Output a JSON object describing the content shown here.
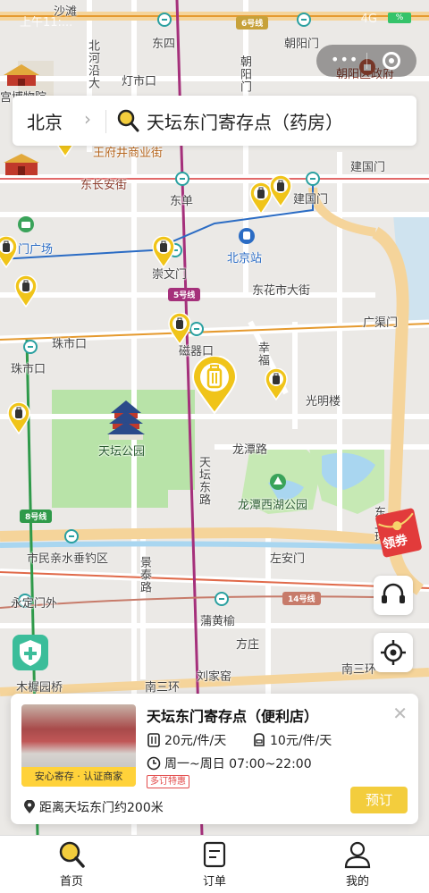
{
  "status_bar": {
    "carrier": "上午11:...",
    "signal": "4G",
    "battery": "%"
  },
  "search": {
    "city": "北京",
    "query": "天坛东门寄存点（药房）"
  },
  "map": {
    "labels": {
      "shatan": "沙滩",
      "dongsi": "东四",
      "chaoyangmen": "朝阳门",
      "line6": "6号线",
      "beiheyan": "北河沿大",
      "dengshikou": "灯市口",
      "chaoyang_vert": "朝阳门",
      "chaoyang_gov": "朝阳区政府",
      "palace": "宫博物院",
      "wangfujing": "王府井商业街",
      "jianguomen": "建国门",
      "jianguomen_st": "建国门",
      "dongchangan": "东长安街",
      "dongdan": "东单",
      "menguangchang": "门广场",
      "beijingzhan": "北京站",
      "chongwenmen": "崇文门",
      "line5": "5号线",
      "donghuashi": "东花市大街",
      "guangqumen": "广渠门",
      "zhushikou_road": "珠市口",
      "zhushikou": "珠市口",
      "ciqikou": "磁器口",
      "xingfu": "幸福",
      "guangminglou": "光明楼",
      "tiantan_park": "天坛公园",
      "longtanlu": "龙潭路",
      "tiantandonglu": "天坛东路",
      "longtanxihu": "龙潭西湖公园",
      "line8": "8号线",
      "shiminqin": "市民亲水垂钓区",
      "zuoanmen": "左安门",
      "jingtailu": "景泰路",
      "yongdingmenwai": "永定门外",
      "line14": "14号线",
      "puhuangyu": "蒲黄榆",
      "fangzhuang": "方庄",
      "liujiayao": "刘家窑",
      "nansanhuan": "南三环",
      "nansanhuan2": "南三环",
      "muxiyuan": "木樨园桥",
      "donger": "东二环"
    }
  },
  "coupon": {
    "label": "领券"
  },
  "card": {
    "title": "天坛东门寄存点（便利店）",
    "badge": "安心寄存 · 认证商家",
    "price_large": "20元/件/天",
    "price_small": "10元/件/天",
    "hours": "周一~周日 07:00~22:00",
    "promo": "多订特惠",
    "distance": "距离天坛东门约200米",
    "book": "预订"
  },
  "tabs": [
    {
      "label": "首页",
      "icon": "search-icon"
    },
    {
      "label": "订单",
      "icon": "order-icon"
    },
    {
      "label": "我的",
      "icon": "user-icon"
    }
  ],
  "colors": {
    "accent": "#f3cd3d",
    "pin": "#f0c419",
    "park": "#b8e3a8"
  }
}
